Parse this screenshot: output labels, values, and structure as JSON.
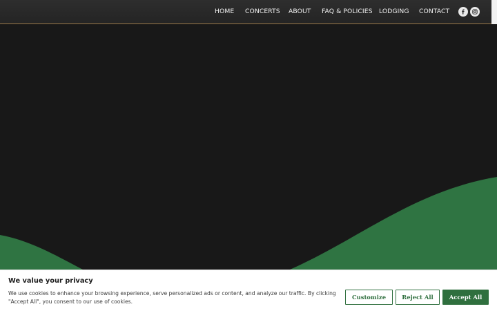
{
  "nav": {
    "items": [
      "HOME",
      "CONCERTS",
      "ABOUT",
      "FAQ & POLICIES",
      "LODGING",
      "CONTACT"
    ],
    "social": [
      "facebook-icon",
      "instagram-icon"
    ]
  },
  "colors": {
    "header_bg": "#2a2a2a",
    "header_border": "#9c7a4a",
    "hero_bg": "#181818",
    "wave_green": "#2f7442",
    "accent_green": "#2f6f3e"
  },
  "cookie": {
    "title": "We value your privacy",
    "text": "We use cookies to enhance your browsing experience, serve personalized ads or content, and analyze our traffic. By clicking \"Accept All\", you consent to our use of cookies.",
    "customize": "Customize",
    "reject": "Reject All",
    "accept": "Accept All"
  }
}
